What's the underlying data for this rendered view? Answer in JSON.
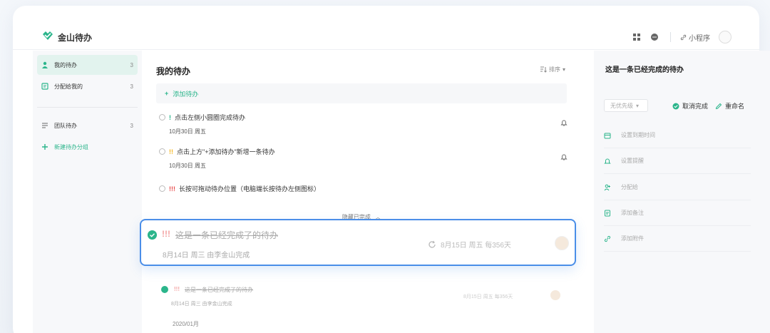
{
  "app": {
    "title": "金山待办",
    "accent": "#2bb58b"
  },
  "toolbar": {
    "miniapp_label": "小程序"
  },
  "sidebar": {
    "items": [
      {
        "label": "我的待办",
        "count": "3",
        "icon": "person-icon"
      },
      {
        "label": "分配给我的",
        "count": "3",
        "icon": "assigned-icon"
      },
      {
        "label": "团队待办",
        "count": "3",
        "icon": "list-icon"
      }
    ],
    "add_group_label": "新建待办分组"
  },
  "main": {
    "title": "我的待办",
    "sort_label": "排序",
    "add_label": "添加待办",
    "tasks": [
      {
        "priority": "!",
        "title": "点击左侧小圆圈完成待办",
        "date": "10月30日  周五",
        "has_bell": true
      },
      {
        "priority": "!!",
        "title": "点击上方\"+添加待办\"新增一条待办",
        "date": "10月30日  周五",
        "has_bell": true
      },
      {
        "priority": "!!!",
        "title": "长按可拖动待办位置（电脑端长按待办左侧图标）",
        "date": "",
        "has_bell": false
      }
    ],
    "hide_done_label": "隐藏已完成",
    "selected_task": {
      "priority": "!!!",
      "title": "这是一条已经完成了的待办",
      "meta": "8月14日  周三  由李金山完成",
      "repeat": "8月15日  周五  每356天"
    },
    "month_label": "2020/01月",
    "done_task": {
      "priority": "!!!",
      "title": "这是一条已经完成了的待办",
      "meta": "8月14日  周三  由李金山完成",
      "repeat": "8月15日  周五  每356天"
    }
  },
  "detail": {
    "title": "这是一条已经完成的待办",
    "priority_select": "无优先级",
    "cancel_done_label": "取消完成",
    "rename_label": "重命名",
    "items": [
      {
        "label": "设置到期时间",
        "icon": "calendar-icon"
      },
      {
        "label": "设置提醒",
        "icon": "bell-icon"
      },
      {
        "label": "分配给",
        "icon": "assign-icon"
      },
      {
        "label": "添加备注",
        "icon": "note-icon"
      },
      {
        "label": "添加附件",
        "icon": "attachment-icon"
      }
    ]
  },
  "colors": {
    "priority_1": "#2bb58b",
    "priority_2": "#f5b723",
    "priority_3": "#e84c4c",
    "selection_border": "#4a8ee8"
  }
}
